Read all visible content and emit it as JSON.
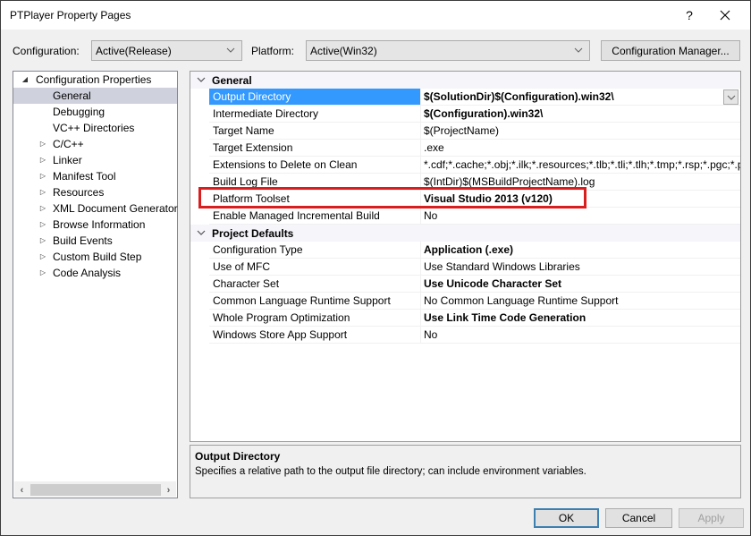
{
  "window": {
    "title": "PTPlayer Property Pages",
    "help_label": "?",
    "close_label": "✕"
  },
  "toolbar": {
    "configuration_label": "Configuration:",
    "configuration_value": "Active(Release)",
    "platform_label": "Platform:",
    "platform_value": "Active(Win32)",
    "config_manager_label": "Configuration Manager..."
  },
  "tree": {
    "root": "Configuration Properties",
    "items": [
      {
        "label": "General",
        "expandable": false,
        "selected": true
      },
      {
        "label": "Debugging",
        "expandable": false
      },
      {
        "label": "VC++ Directories",
        "expandable": false
      },
      {
        "label": "C/C++",
        "expandable": true
      },
      {
        "label": "Linker",
        "expandable": true
      },
      {
        "label": "Manifest Tool",
        "expandable": true
      },
      {
        "label": "Resources",
        "expandable": true
      },
      {
        "label": "XML Document Generator",
        "expandable": true
      },
      {
        "label": "Browse Information",
        "expandable": true
      },
      {
        "label": "Build Events",
        "expandable": true
      },
      {
        "label": "Custom Build Step",
        "expandable": true
      },
      {
        "label": "Code Analysis",
        "expandable": true
      }
    ]
  },
  "grid": {
    "categories": [
      {
        "name": "General",
        "properties": [
          {
            "name": "Output Directory",
            "value": "$(SolutionDir)$(Configuration).win32\\",
            "bold": true,
            "selected": true
          },
          {
            "name": "Intermediate Directory",
            "value": "$(Configuration).win32\\",
            "bold": true
          },
          {
            "name": "Target Name",
            "value": "$(ProjectName)",
            "bold": false
          },
          {
            "name": "Target Extension",
            "value": ".exe",
            "bold": false
          },
          {
            "name": "Extensions to Delete on Clean",
            "value": "*.cdf;*.cache;*.obj;*.ilk;*.resources;*.tlb;*.tli;*.tlh;*.tmp;*.rsp;*.pgc;*.pgd;*.meta;*.tlog;*.manifest;*.res;*.pch;*.exp;*.idb;*.rep;*.xdc;*.pdb;*_manifest.rc;*.bsc;*.sbr;*.xml;*.metagen;*.bi",
            "bold": false
          },
          {
            "name": "Build Log File",
            "value": "$(IntDir)$(MSBuildProjectName).log",
            "bold": false
          },
          {
            "name": "Platform Toolset",
            "value": "Visual Studio 2013 (v120)",
            "bold": true
          },
          {
            "name": "Enable Managed Incremental Build",
            "value": "No",
            "bold": false
          }
        ]
      },
      {
        "name": "Project Defaults",
        "properties": [
          {
            "name": "Configuration Type",
            "value": "Application (.exe)",
            "bold": true
          },
          {
            "name": "Use of MFC",
            "value": "Use Standard Windows Libraries",
            "bold": false
          },
          {
            "name": "Character Set",
            "value": "Use Unicode Character Set",
            "bold": true
          },
          {
            "name": "Common Language Runtime Support",
            "value": "No Common Language Runtime Support",
            "bold": false
          },
          {
            "name": "Whole Program Optimization",
            "value": "Use Link Time Code Generation",
            "bold": true
          },
          {
            "name": "Windows Store App Support",
            "value": "No",
            "bold": false
          }
        ]
      }
    ]
  },
  "description": {
    "title": "Output Directory",
    "text": "Specifies a relative path to the output file directory; can include environment variables."
  },
  "buttons": {
    "ok": "OK",
    "cancel": "Cancel",
    "apply": "Apply"
  },
  "colors": {
    "selection": "#3399ff",
    "tree_selection": "#cfd1dd",
    "highlight_box": "#d81e1e"
  }
}
